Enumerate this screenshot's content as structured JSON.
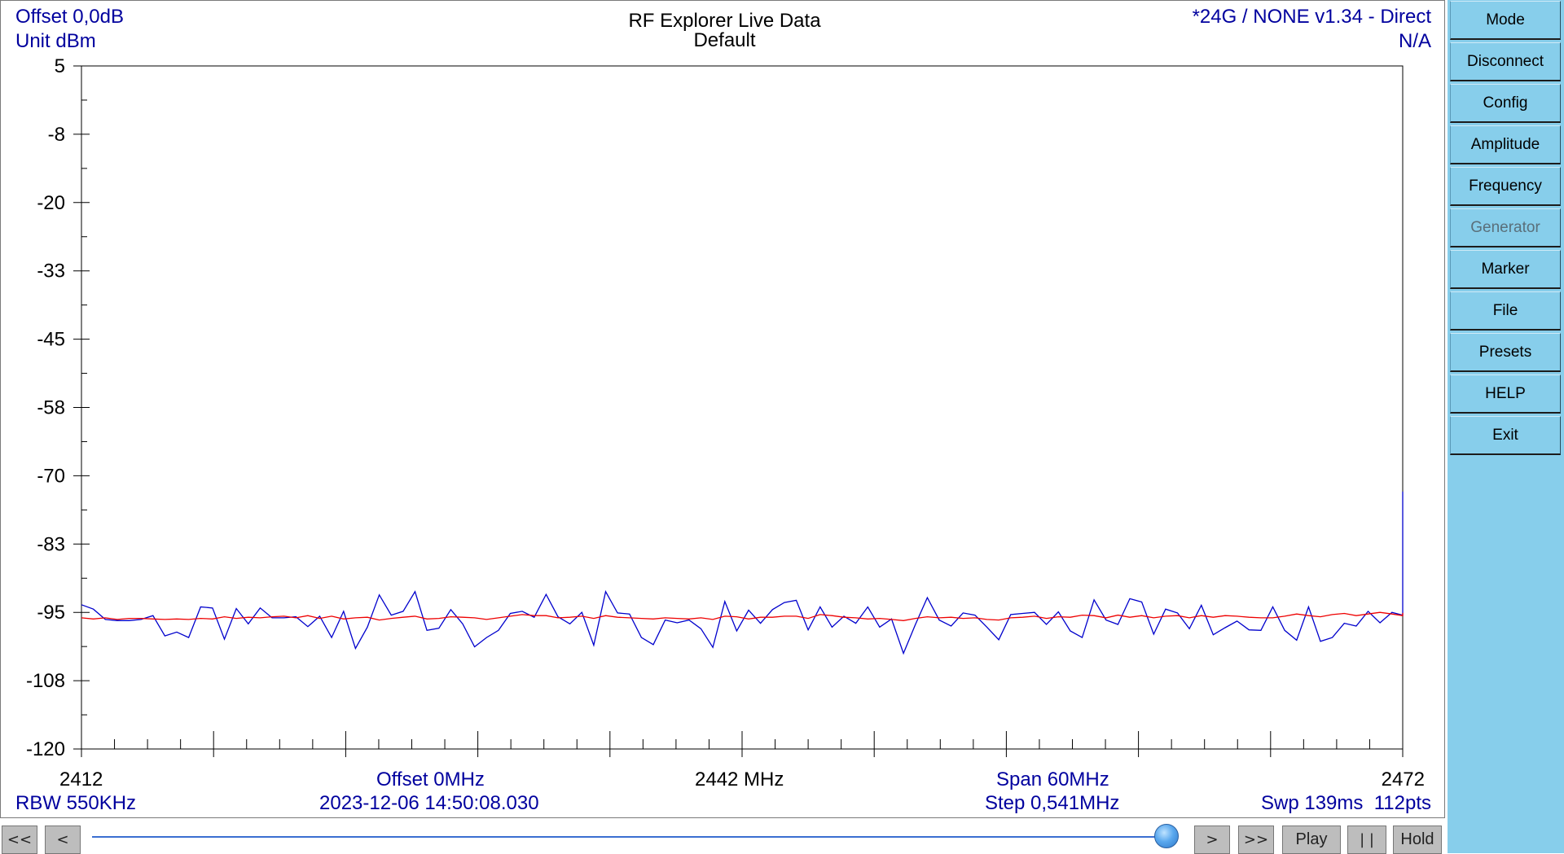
{
  "header": {
    "offset_db": "Offset 0,0dB",
    "unit": "Unit dBm",
    "title": "RF Explorer Live Data",
    "subtitle": "Default",
    "device": "*24G / NONE v1.34 - Direct",
    "status": "N/A"
  },
  "footer": {
    "start_freq": "2412",
    "offset_mhz": "Offset 0MHz",
    "center_freq": "2442 MHz",
    "span": "Span 60MHz",
    "stop_freq": "2472",
    "rbw": "RBW 550KHz",
    "timestamp": "2023-12-06 14:50:08.030",
    "step": "Step 0,541MHz",
    "sweep": "Swp 139ms  112pts"
  },
  "sidebar": {
    "buttons": [
      {
        "label": "Mode",
        "enabled": true
      },
      {
        "label": "Disconnect",
        "enabled": true
      },
      {
        "label": "Config",
        "enabled": true
      },
      {
        "label": "Amplitude",
        "enabled": true
      },
      {
        "label": "Frequency",
        "enabled": true
      },
      {
        "label": "Generator",
        "enabled": false
      },
      {
        "label": "Marker",
        "enabled": true
      },
      {
        "label": "File",
        "enabled": true
      },
      {
        "label": "Presets",
        "enabled": true
      },
      {
        "label": "HELP",
        "enabled": true
      },
      {
        "label": "Exit",
        "enabled": true
      }
    ]
  },
  "controls": {
    "first": "<<",
    "prev": "<",
    "next": ">",
    "last": ">>",
    "play": "Play",
    "pause": "| |",
    "hold": "Hold",
    "slider_position": 0.99
  },
  "colors": {
    "realtime_trace": "#0000cc",
    "average_trace": "#ee0000",
    "label_blue": "#00009e",
    "sidebar_bg": "#87ceeb"
  },
  "chart_data": {
    "type": "line",
    "ylim": [
      -120,
      5
    ],
    "xlim": [
      2412,
      2472
    ],
    "y_ticks": [
      "5",
      "-8",
      "-20",
      "-33",
      "-45",
      "-58",
      "-70",
      "-83",
      "-95",
      "-108",
      "-120"
    ],
    "x_start": 2412,
    "x_step": 0.541,
    "series": [
      {
        "key": "realtime",
        "color": "#0000cc",
        "values": [
          -93.6,
          -94.4,
          -96.3,
          -96.5,
          -96.5,
          -96.3,
          -95.6,
          -99.3,
          -98.6,
          -99.6,
          -94.0,
          -94.2,
          -99.9,
          -94.3,
          -97.1,
          -94.2,
          -96.0,
          -96.0,
          -95.8,
          -97.6,
          -95.7,
          -99.6,
          -94.8,
          -101.6,
          -97.7,
          -91.8,
          -95.5,
          -94.8,
          -91.2,
          -98.3,
          -97.9,
          -94.5,
          -97.1,
          -101.3,
          -99.6,
          -98.3,
          -95.2,
          -94.8,
          -95.9,
          -91.7,
          -95.8,
          -97.1,
          -95.0,
          -101.0,
          -91.2,
          -95.1,
          -95.3,
          -99.6,
          -100.9,
          -96.4,
          -96.9,
          -96.4,
          -98.0,
          -101.4,
          -93.0,
          -98.4,
          -94.6,
          -97.0,
          -94.5,
          -93.2,
          -92.8,
          -98.2,
          -94.0,
          -97.7,
          -95.7,
          -97.0,
          -94.0,
          -97.7,
          -96.2,
          -102.5,
          -97.2,
          -92.3,
          -96.4,
          -97.5,
          -95.1,
          -95.5,
          -97.7,
          -100.0,
          -95.4,
          -95.2,
          -95.0,
          -97.2,
          -94.9,
          -98.4,
          -99.6,
          -92.7,
          -96.4,
          -97.2,
          -92.5,
          -93.1,
          -99.0,
          -94.4,
          -95.1,
          -98.0,
          -93.7,
          -99.1,
          -97.8,
          -96.6,
          -98.2,
          -98.3,
          -94.0,
          -98.3,
          -100.1,
          -94.0,
          -100.3,
          -99.6,
          -97.0,
          -97.5,
          -94.8,
          -96.9,
          -95.0,
          -95.5,
          -72.9,
          -76.2
        ]
      },
      {
        "key": "average",
        "color": "#ee0000",
        "values": [
          -96.0,
          -96.2,
          -96.0,
          -96.3,
          -96.1,
          -96.1,
          -96.2,
          -96.3,
          -96.2,
          -96.3,
          -96.1,
          -96.2,
          -95.8,
          -96.1,
          -95.9,
          -96.0,
          -95.8,
          -95.7,
          -96.0,
          -95.6,
          -96.1,
          -95.7,
          -96.2,
          -96.0,
          -95.9,
          -96.4,
          -96.1,
          -95.9,
          -95.7,
          -96.2,
          -96.1,
          -95.8,
          -95.9,
          -96.0,
          -96.3,
          -96.0,
          -95.7,
          -95.4,
          -95.6,
          -95.6,
          -96.0,
          -95.9,
          -95.7,
          -96.1,
          -95.6,
          -95.9,
          -96.0,
          -96.1,
          -96.2,
          -96.0,
          -96.1,
          -96.2,
          -96.0,
          -96.3,
          -95.7,
          -95.8,
          -96.2,
          -95.9,
          -95.9,
          -95.7,
          -95.7,
          -96.1,
          -95.4,
          -95.6,
          -95.9,
          -96.0,
          -96.2,
          -96.1,
          -96.3,
          -96.5,
          -96.1,
          -95.8,
          -96.0,
          -95.9,
          -96.1,
          -96.0,
          -96.3,
          -96.4,
          -96.0,
          -95.9,
          -95.7,
          -96.1,
          -95.8,
          -95.9,
          -95.5,
          -95.6,
          -96.0,
          -95.5,
          -95.9,
          -95.6,
          -96.0,
          -95.7,
          -95.6,
          -96.0,
          -95.6,
          -95.9,
          -95.6,
          -95.7,
          -95.9,
          -96.0,
          -96.0,
          -95.7,
          -95.3,
          -95.6,
          -95.8,
          -95.4,
          -95.2,
          -95.6,
          -95.3,
          -95.0,
          -95.3,
          -95.6,
          -95.5,
          -95.1
        ]
      }
    ]
  }
}
